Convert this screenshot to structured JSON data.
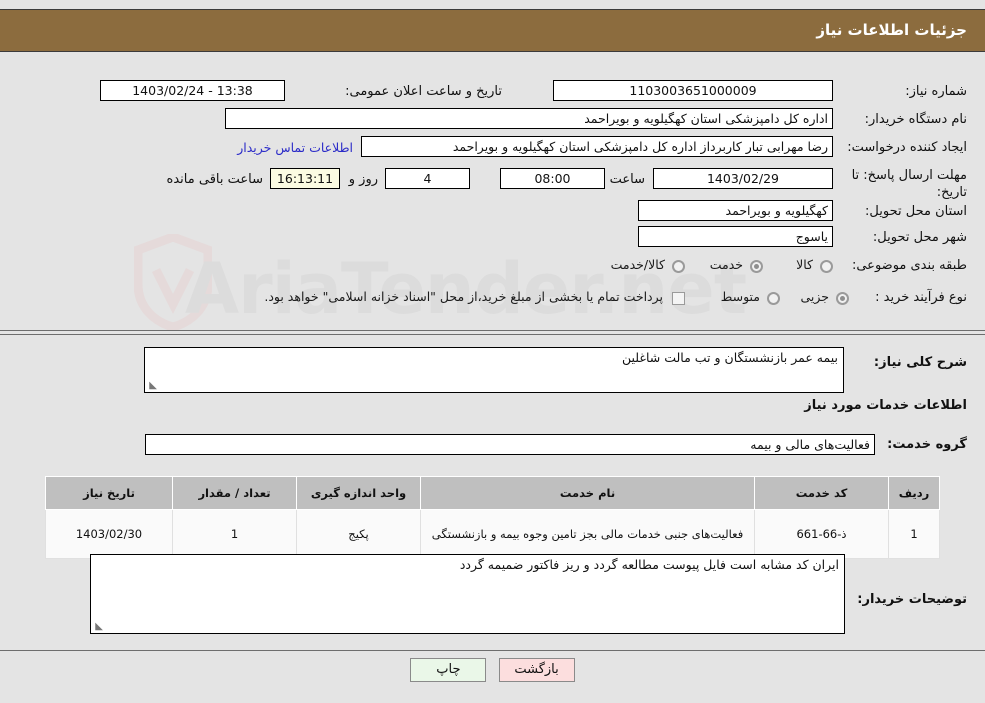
{
  "header": {
    "title": "جزئیات اطلاعات نیاز"
  },
  "form": {
    "need_number_label": "شماره نیاز:",
    "need_number_value": "1103003651000009",
    "announce_label": "تاریخ و ساعت اعلان عمومی:",
    "announce_value": "13:38 - 1403/02/24",
    "buyer_org_label": "نام دستگاه خریدار:",
    "buyer_org_value": "اداره کل دامپزشکی استان کهگیلویه و بویراحمد",
    "creator_label": "ایجاد کننده درخواست:",
    "creator_value": "رضا مهرابی تبار کاربرداز اداره کل دامپزشکی استان کهگیلویه و بویراحمد",
    "contact_link": "اطلاعات تماس خریدار",
    "deadline_label": "مهلت ارسال پاسخ: تا تاریخ:",
    "deadline_date": "1403/02/29",
    "hour_label": "ساعت",
    "deadline_time": "08:00",
    "remaining_days": "4",
    "days_label": "روز و",
    "remaining_time": "16:13:11",
    "remaining_suffix": "ساعت باقی مانده",
    "province_label": "استان محل تحویل:",
    "province_value": "کهگیلویه و بویراحمد",
    "city_label": "شهر محل تحویل:",
    "city_value": "یاسوج",
    "category_label": "طبقه بندی موضوعی:",
    "category_options": [
      {
        "label": "کالا",
        "selected": false
      },
      {
        "label": "خدمت",
        "selected": true
      },
      {
        "label": "کالا/خدمت",
        "selected": false
      }
    ],
    "process_label": "نوع فرآیند خرید :",
    "process_options": [
      {
        "label": "جزیی",
        "selected": true
      },
      {
        "label": "متوسط",
        "selected": false
      }
    ],
    "treasury_checkbox_label": "پرداخت تمام یا بخشی از مبلغ خرید،از محل \"اسناد خزانه اسلامی\" خواهد بود.",
    "treasury_checked": false
  },
  "summary": {
    "label": "شرح کلی نیاز:",
    "value": "بیمه عمر بازنشستگان و تب مالت شاغلین"
  },
  "services_section": {
    "heading": "اطلاعات خدمات مورد نیاز",
    "group_label": "گروه خدمت:",
    "group_value": "فعالیت‌های مالی و بیمه"
  },
  "table": {
    "columns": [
      "ردیف",
      "کد خدمت",
      "نام خدمت",
      "واحد اندازه گیری",
      "تعداد / مقدار",
      "تاریخ نیاز"
    ],
    "rows": [
      {
        "row": "1",
        "code": "ذ-66-661",
        "name": "فعالیت‌های جنبی خدمات مالی بجز تامین وجوه بیمه و بازنشستگی",
        "unit": "پکیج",
        "qty": "1",
        "date": "1403/02/30"
      }
    ]
  },
  "notes": {
    "label": "توضیحات خریدار:",
    "value": "ایران کد مشابه است فایل پیوست مطالعه گردد و ریز فاکتور ضمیمه گردد"
  },
  "buttons": {
    "print": "چاپ",
    "back": "بازگشت"
  },
  "watermark": {
    "text": "AriaTender.net"
  }
}
